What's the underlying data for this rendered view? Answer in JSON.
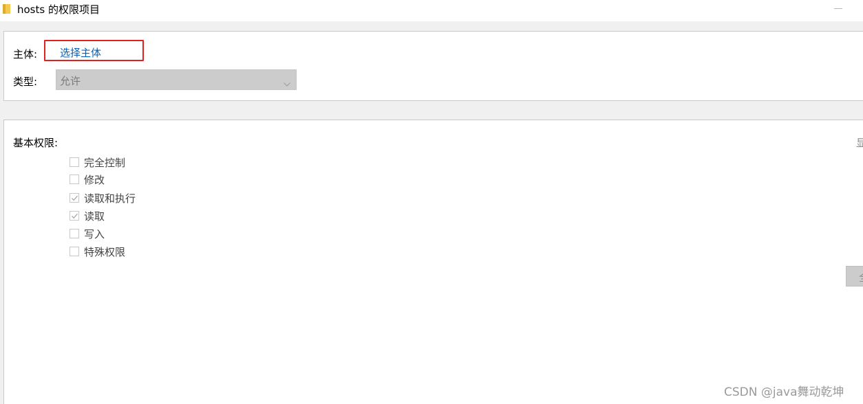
{
  "window": {
    "title": "hosts 的权限项目",
    "icon": "folder-icon",
    "controls": [
      "minimize-icon"
    ]
  },
  "principal": {
    "label": "主体:",
    "link": "选择主体",
    "highlight_color": "#e02020",
    "link_color": "#0a5fb4"
  },
  "type": {
    "label": "类型:",
    "value": "允许",
    "icon": "chevron-down-icon"
  },
  "basic_permissions": {
    "label": "基本权限:",
    "show_advanced_link": "显",
    "items": [
      {
        "label": "完全控制",
        "checked": false
      },
      {
        "label": "修改",
        "checked": false
      },
      {
        "label": "读取和执行",
        "checked": true
      },
      {
        "label": "读取",
        "checked": true
      },
      {
        "label": "写入",
        "checked": false
      },
      {
        "label": "特殊权限",
        "checked": false
      }
    ],
    "clear_all_button": "全"
  },
  "watermark": "CSDN @java舞动乾坤"
}
